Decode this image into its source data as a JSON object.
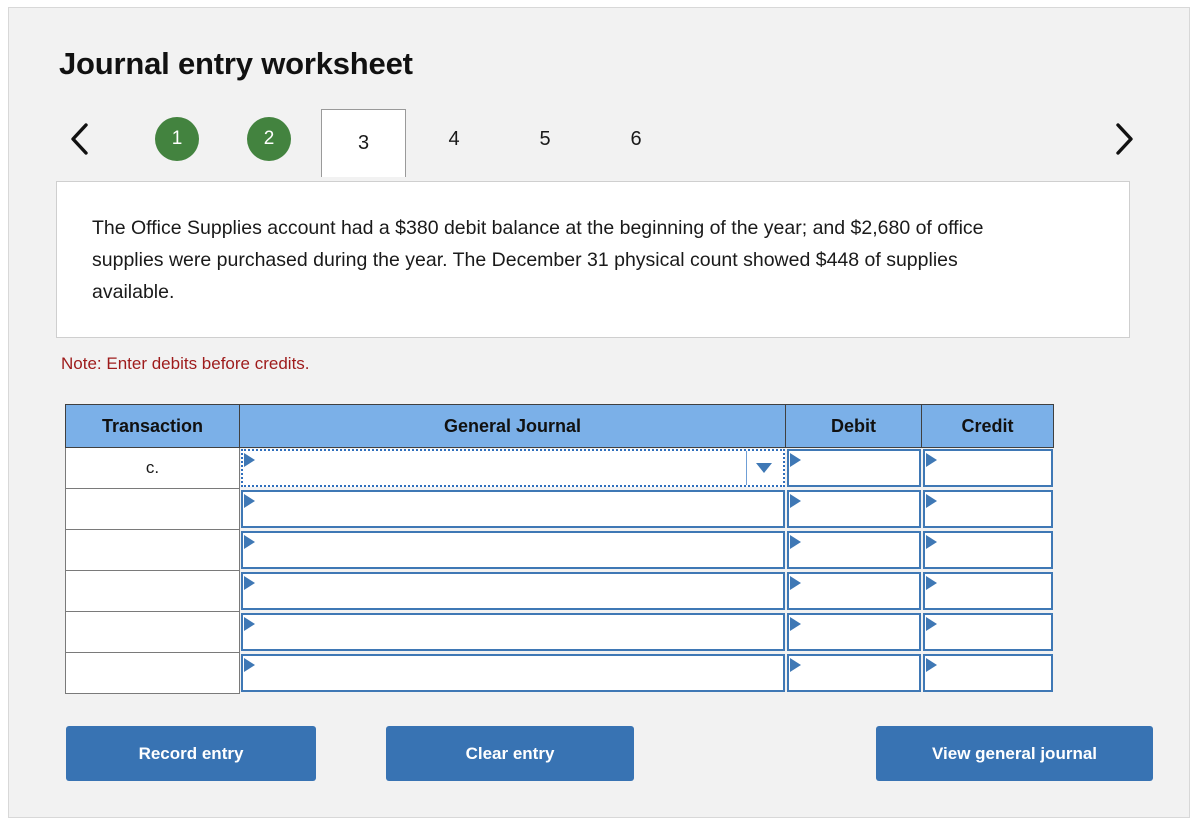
{
  "header": {
    "title": "Journal entry worksheet"
  },
  "nav": {
    "prev_icon": "chevron-left-icon",
    "next_icon": "chevron-right-icon",
    "tabs": [
      {
        "label": "1",
        "state": "done"
      },
      {
        "label": "2",
        "state": "done"
      },
      {
        "label": "3",
        "state": "active"
      },
      {
        "label": "4",
        "state": "plain"
      },
      {
        "label": "5",
        "state": "plain"
      },
      {
        "label": "6",
        "state": "plain"
      }
    ]
  },
  "question": {
    "text": "The Office Supplies account had a $380 debit balance at the beginning of the year; and $2,680 of office supplies were purchased during the year. The December 31 physical count showed $448 of supplies available."
  },
  "note": {
    "text": "Note: Enter debits before credits."
  },
  "table": {
    "headers": {
      "transaction": "Transaction",
      "general_journal": "General Journal",
      "debit": "Debit",
      "credit": "Credit"
    },
    "rows": [
      {
        "transaction": "c.",
        "general_journal": "",
        "debit": "",
        "credit": "",
        "selected": true
      },
      {
        "transaction": "",
        "general_journal": "",
        "debit": "",
        "credit": "",
        "selected": false
      },
      {
        "transaction": "",
        "general_journal": "",
        "debit": "",
        "credit": "",
        "selected": false
      },
      {
        "transaction": "",
        "general_journal": "",
        "debit": "",
        "credit": "",
        "selected": false
      },
      {
        "transaction": "",
        "general_journal": "",
        "debit": "",
        "credit": "",
        "selected": false
      },
      {
        "transaction": "",
        "general_journal": "",
        "debit": "",
        "credit": "",
        "selected": false
      }
    ]
  },
  "buttons": {
    "record": "Record entry",
    "clear": "Clear entry",
    "view": "View general journal"
  },
  "colors": {
    "page_background": "#f2f2f2",
    "tab_done": "#43833f",
    "table_header": "#7bb0e8",
    "cell_border": "#3f78b5",
    "button": "#3873b3",
    "note_text": "#9e1b1b"
  }
}
